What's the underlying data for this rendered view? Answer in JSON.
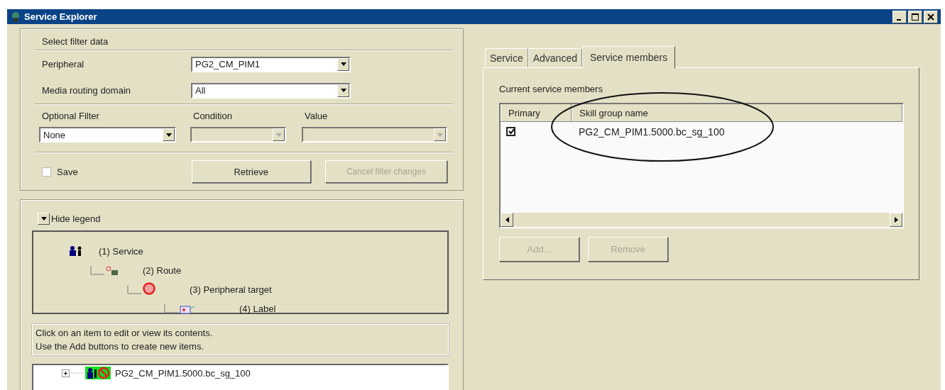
{
  "window": {
    "title": "Service Explorer"
  },
  "filter": {
    "title": "Select filter data",
    "fields": [
      {
        "label": "Peripheral",
        "value": "PG2_CM_PIM1"
      },
      {
        "label": "Media routing domain",
        "value": "All"
      }
    ],
    "optional": [
      {
        "label": "Optional Filter",
        "value": "None",
        "disabled": false
      },
      {
        "label": "Condition",
        "disabled": true
      },
      {
        "label": "Value",
        "disabled": true
      }
    ],
    "save": {
      "label": "Save",
      "checked": false
    },
    "buttons": [
      {
        "label": "Retrieve",
        "disabled": false
      },
      {
        "label": "Cancel filter changes",
        "disabled": true
      }
    ]
  },
  "legend": {
    "toggle": "Hide legend",
    "items": [
      {
        "kind": "service",
        "label": "(1) Service",
        "children": [
          {
            "kind": "route",
            "label": "(2) Route",
            "children": [
              {
                "kind": "target",
                "label": "(3) Peripheral target",
                "children": [
                  {
                    "kind": "label",
                    "label": "(4) Label"
                  }
                ]
              }
            ]
          }
        ]
      }
    ]
  },
  "hint": [
    "Click on an item to edit or view its contents.",
    "Use the Add buttons to create new items."
  ],
  "tree": [
    {
      "label": "PG2_CM_PIM1.5000.bc_sg_100",
      "expanded": false
    }
  ],
  "tabs": [
    {
      "label": "Service",
      "selected": false
    },
    {
      "label": "Advanced",
      "selected": false
    },
    {
      "label": "Service members",
      "selected": true
    }
  ],
  "members": {
    "title": "Current service members",
    "columns": [
      "Primary",
      "Skill group name"
    ],
    "rows": [
      {
        "primary": true,
        "name": "PG2_CM_PIM1.5000.bc_sg_100"
      }
    ],
    "buttons": [
      {
        "label": "Add...",
        "disabled": true
      },
      {
        "label": "Remove",
        "disabled": true
      }
    ]
  }
}
